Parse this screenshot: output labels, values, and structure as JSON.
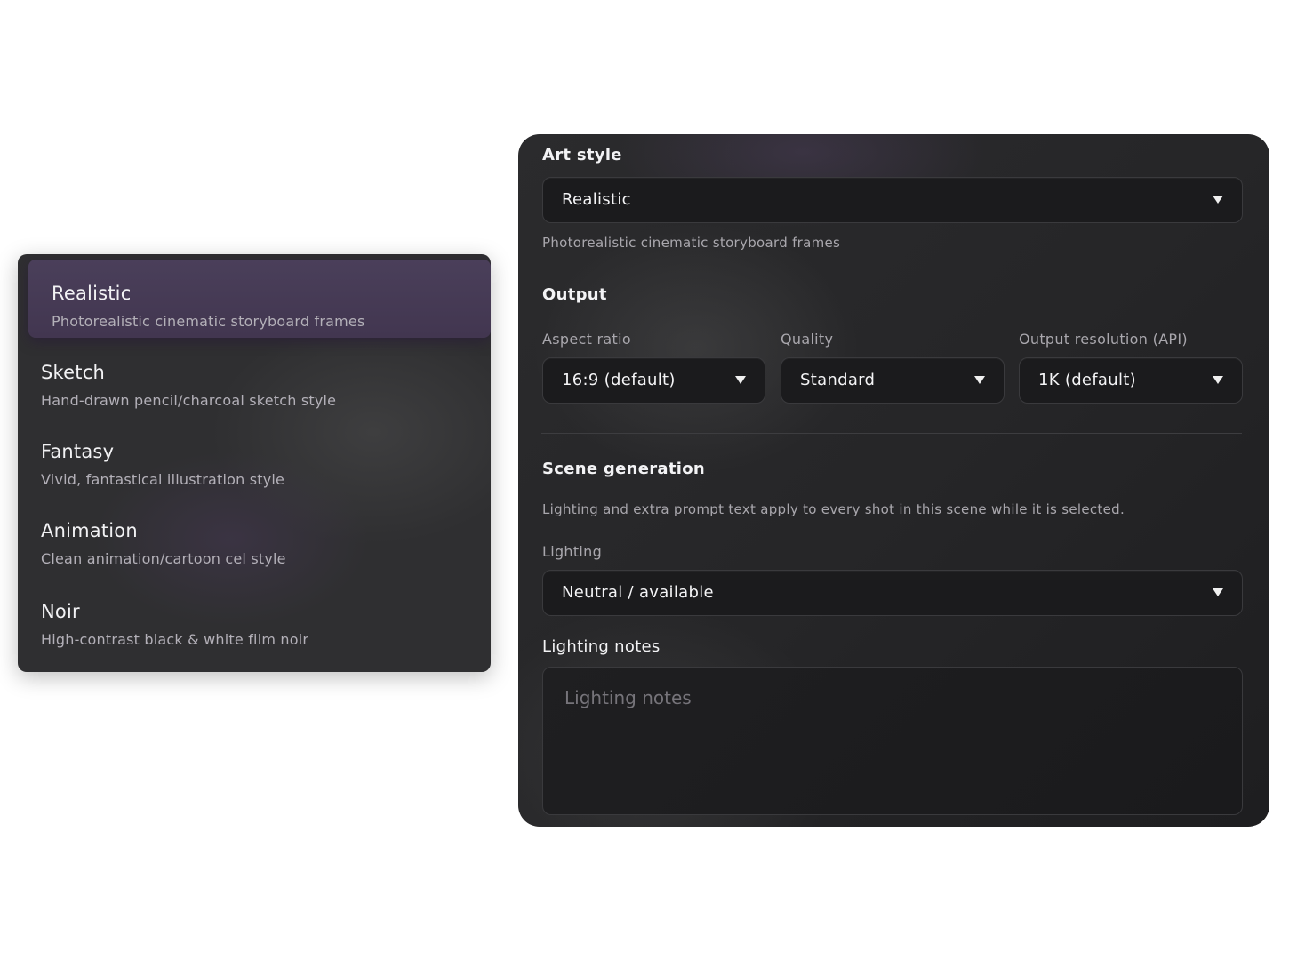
{
  "style_menu": {
    "items": [
      {
        "title": "Realistic",
        "description": "Photorealistic cinematic storyboard frames",
        "selected": true
      },
      {
        "title": "Sketch",
        "description": "Hand-drawn pencil/charcoal sketch style",
        "selected": false
      },
      {
        "title": "Fantasy",
        "description": "Vivid, fantastical illustration style",
        "selected": false
      },
      {
        "title": "Animation",
        "description": "Clean animation/cartoon cel style",
        "selected": false
      },
      {
        "title": "Noir",
        "description": "High-contrast black & white film noir",
        "selected": false
      }
    ],
    "selected_color": "#463a55"
  },
  "panel": {
    "art_style": {
      "label": "Art style",
      "value": "Realistic",
      "description": "Photorealistic cinematic storyboard frames",
      "caret_icon": "triangle-down-icon"
    },
    "output": {
      "label": "Output",
      "aspect_ratio": {
        "label": "Aspect ratio",
        "value": "16:9 (default)"
      },
      "quality": {
        "label": "Quality",
        "value": "Standard"
      },
      "resolution": {
        "label": "Output resolution (API)",
        "value": "1K (default)"
      }
    },
    "scene_generation": {
      "label": "Scene generation",
      "hint": "Lighting and extra prompt text apply to every shot in this scene while it is selected.",
      "lighting": {
        "label": "Lighting",
        "value": "Neutral / available"
      },
      "lighting_notes": {
        "label": "Lighting notes",
        "placeholder": "Lighting notes",
        "value": ""
      }
    }
  },
  "colors": {
    "panel_bg": "#262628",
    "field_bg": "#1b1b1d",
    "text_primary": "#f3f3f5",
    "text_secondary": "#a9a7ad"
  }
}
